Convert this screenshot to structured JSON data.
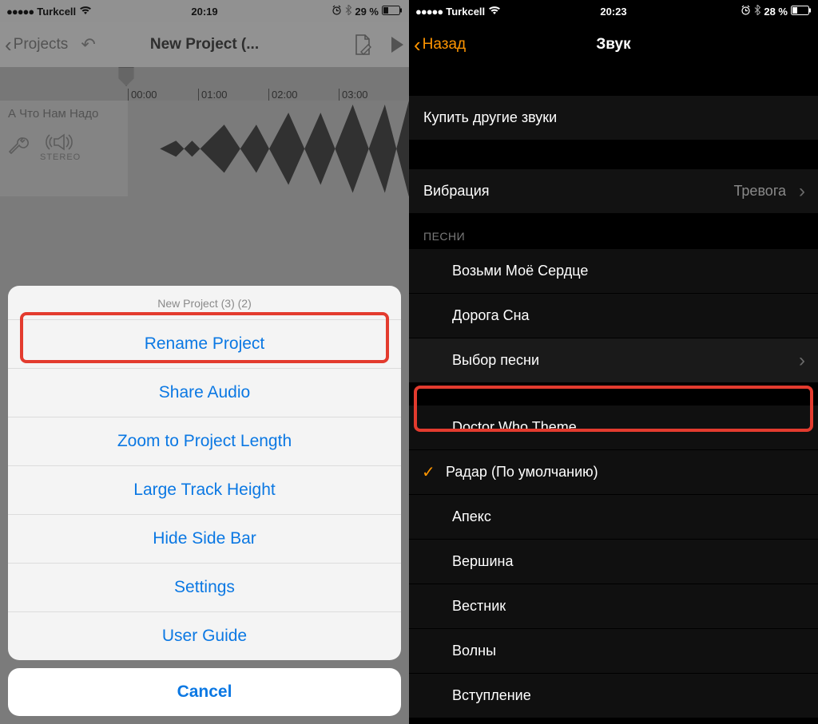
{
  "left": {
    "status": {
      "carrier": "Turkcell",
      "signal_dots": "●●●●●",
      "time": "20:19",
      "battery_pct": "29 %"
    },
    "nav": {
      "back_label": "Projects",
      "title": "New Project (..."
    },
    "ruler": [
      "00:00",
      "01:00",
      "02:00",
      "03:00"
    ],
    "track": {
      "name": "А Что Нам Надо",
      "stereo_label": "STEREO"
    },
    "sheet": {
      "title": "New Project (3) (2)",
      "items": [
        "Rename Project",
        "Share Audio",
        "Zoom to Project Length",
        "Large Track Height",
        "Hide Side Bar",
        "Settings",
        "User Guide"
      ],
      "cancel": "Cancel",
      "highlighted_index": 1
    }
  },
  "right": {
    "status": {
      "carrier": "Turkcell",
      "signal_dots": "●●●●●",
      "time": "20:23",
      "battery_pct": "28 %"
    },
    "nav": {
      "back_label": "Назад",
      "title": "Звук"
    },
    "buy_row": "Купить другие звуки",
    "vibration": {
      "label": "Вибрация",
      "value": "Тревога"
    },
    "songs_header": "ПЕСНИ",
    "songs_top": [
      "Возьми Моё Сердце",
      "Дорога Сна",
      "Выбор песни"
    ],
    "songs_top_highlight_index": 2,
    "songs_top_chev_index": 2,
    "default_label": "Радар (По умолчанию)",
    "songs_bottom": [
      "Doctor Who Theme",
      "Апекс",
      "Вершина",
      "Вестник",
      "Волны",
      "Вступление"
    ]
  }
}
